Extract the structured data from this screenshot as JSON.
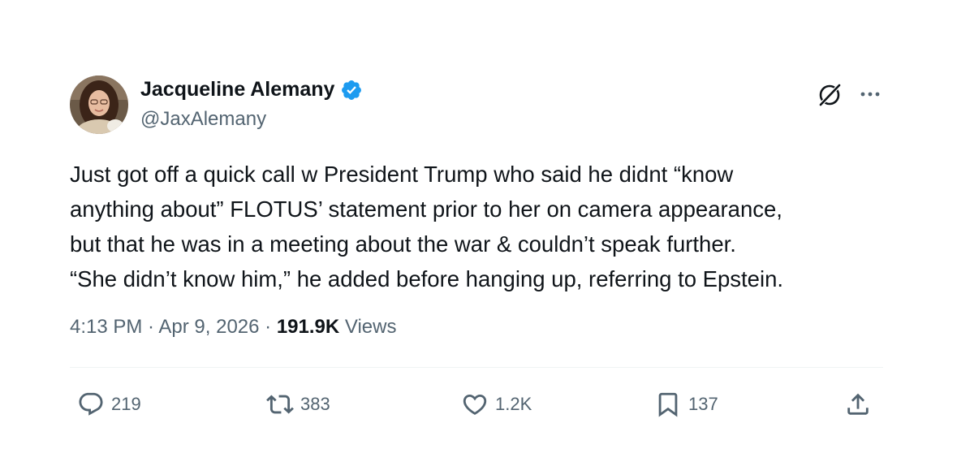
{
  "author": {
    "display_name": "Jacqueline Alemany",
    "handle": "@JaxAlemany",
    "verified": true,
    "verified_color": "#1d9bf0"
  },
  "icons": {
    "header_right": [
      "grok-icon",
      "more-icon"
    ],
    "actions": [
      "reply-icon",
      "repost-icon",
      "like-icon",
      "bookmark-icon",
      "share-icon"
    ]
  },
  "tweet": {
    "lines": [
      "Just got off a quick call w President Trump who said he didnt “know",
      "anything about” FLOTUS’ statement prior to her on camera appearance,",
      "but that he was in a meeting about the war & couldn’t speak further.",
      "“She didn’t know him,” he added before hanging up, referring to Epstein."
    ]
  },
  "meta": {
    "time": "4:13 PM",
    "separator": " · ",
    "date": "Apr 9, 2026",
    "views_count": "191.9K",
    "views_label": " Views"
  },
  "actions": {
    "replies": "219",
    "reposts": "383",
    "likes": "1.2K",
    "bookmarks": "137"
  },
  "colors": {
    "text": "#0f1419",
    "secondary": "#536471",
    "divider": "#eff3f4"
  }
}
